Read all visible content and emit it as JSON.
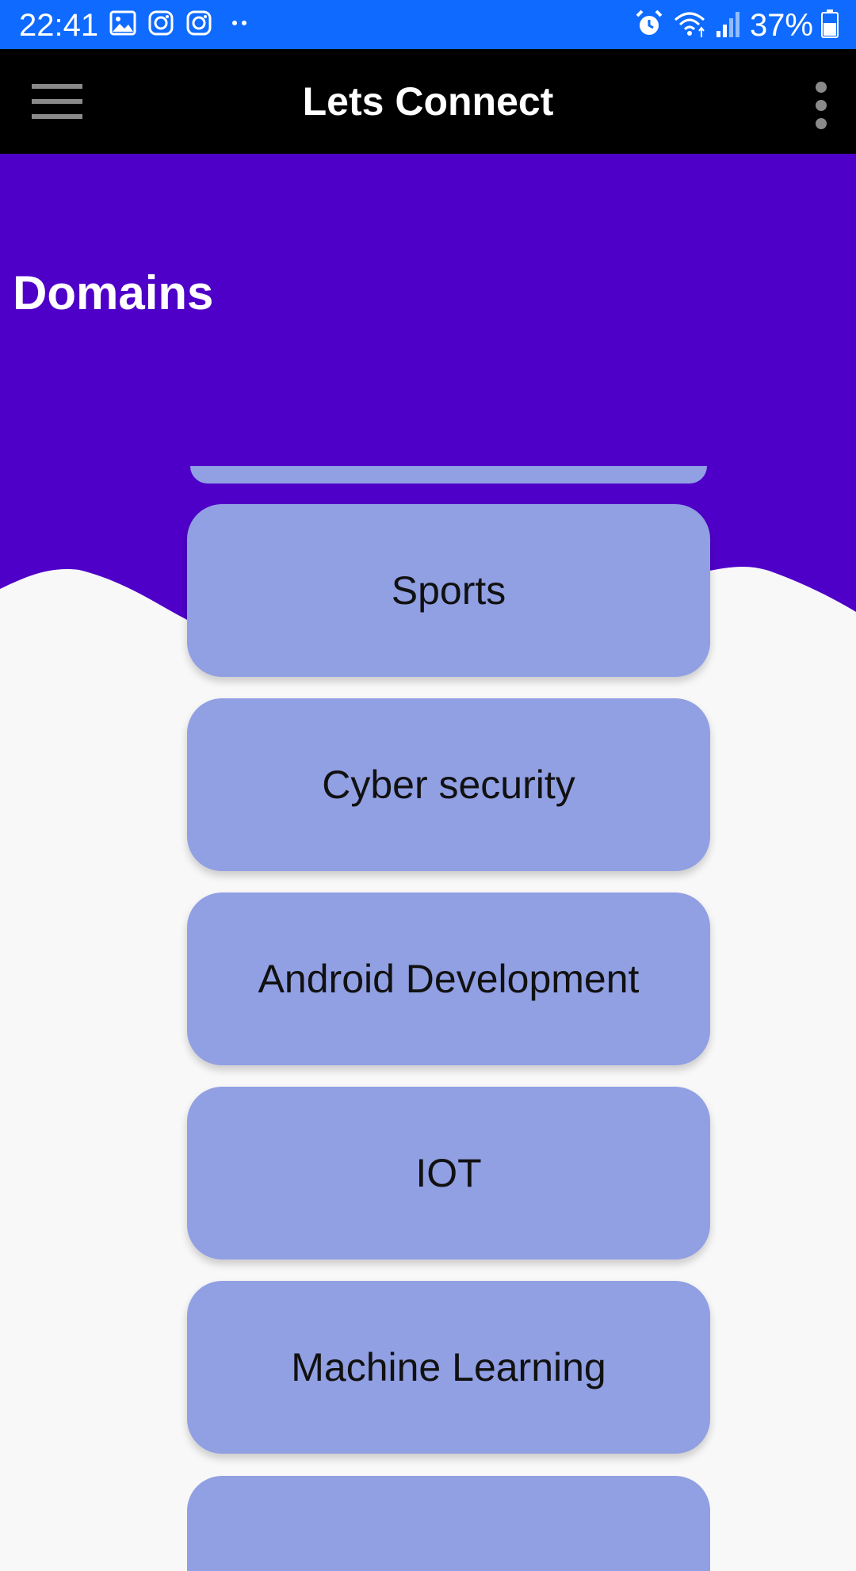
{
  "status_bar": {
    "time": "22:41",
    "battery": "37%",
    "notification_icons": [
      "gallery-icon",
      "instagram-icon",
      "instagram-icon",
      "more-notifications-icon"
    ],
    "system_icons": [
      "alarm-icon",
      "wifi-icon",
      "signal-icon",
      "battery-icon"
    ],
    "color": "#0f6bff"
  },
  "app_bar": {
    "title": "Lets Connect",
    "menu_icon": "hamburger-menu-icon",
    "overflow_icon": "more-vert-icon",
    "color": "#000000"
  },
  "header": {
    "title": "Domains",
    "color": "#4f00c8"
  },
  "domains": [
    {
      "label": "Sports"
    },
    {
      "label": "Cyber security"
    },
    {
      "label": "Android Development"
    },
    {
      "label": "IOT"
    },
    {
      "label": "Machine Learning"
    }
  ],
  "card_color": "#919fe3"
}
